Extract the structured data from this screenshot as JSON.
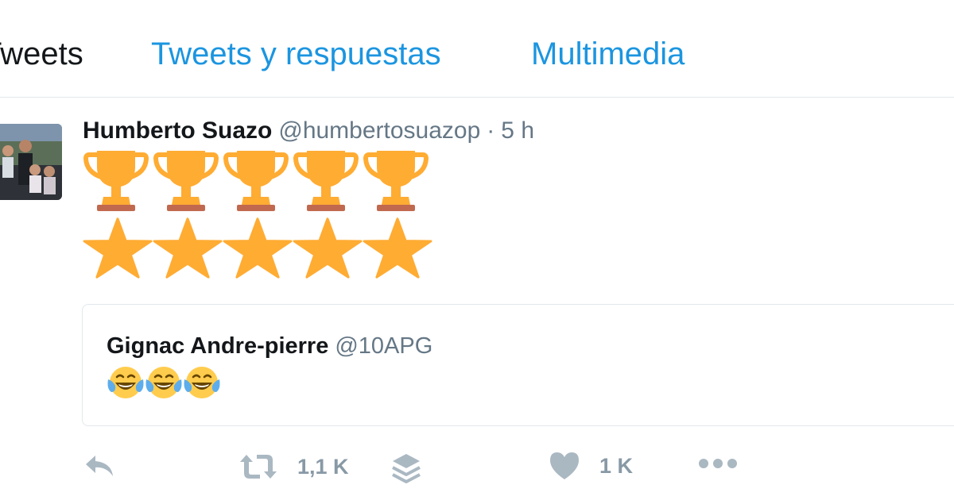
{
  "tabs": [
    {
      "label": "Tweets",
      "active": true
    },
    {
      "label": "Tweets y respuestas",
      "active": false
    },
    {
      "label": "Multimedia",
      "active": false
    }
  ],
  "tweet": {
    "author_name": "Humberto Suazo",
    "author_handle": "@humbertosuazop",
    "separator": "·",
    "time": "5 h",
    "emoji_rows": [
      {
        "icon": "trophy-icon",
        "count": 5
      },
      {
        "icon": "star-icon",
        "count": 5
      }
    ]
  },
  "quoted_tweet": {
    "author_name": "Gignac Andre-pierre",
    "author_handle": "@10APG",
    "emoji": {
      "icon": "face-with-tears-of-joy-icon",
      "count": 3
    }
  },
  "actions": {
    "reply_icon": "reply-icon",
    "retweet_icon": "retweet-icon",
    "retweet_count": "1,1 K",
    "layers_icon": "layers-icon",
    "like_icon": "heart-icon",
    "like_count": "1 K",
    "more_icon": "more-dots-icon"
  },
  "colors": {
    "link_blue": "#1b95e0",
    "text_dark": "#14171a",
    "text_gray": "#657786",
    "icon_gray": "#aab8c2",
    "border": "#e1e8ed",
    "gold": "#ffac33"
  }
}
